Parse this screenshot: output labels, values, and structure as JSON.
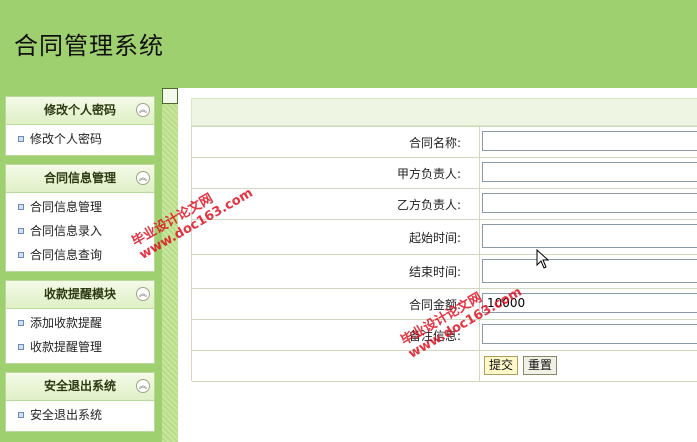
{
  "app": {
    "title": "合同管理系统"
  },
  "sidebar": {
    "panels": [
      {
        "title": "修改个人密码",
        "items": [
          "修改个人密码"
        ]
      },
      {
        "title": "合同信息管理",
        "items": [
          "合同信息管理",
          "合同信息录入",
          "合同信息查询"
        ]
      },
      {
        "title": "收款提醒模块",
        "items": [
          "添加收款提醒",
          "收款提醒管理"
        ]
      },
      {
        "title": "安全退出系统",
        "items": [
          "安全退出系统"
        ]
      }
    ]
  },
  "form": {
    "contract_name_label": "合同名称:",
    "party_a_label": "甲方负责人:",
    "party_b_label": "乙方负责人:",
    "start_time_label": "起始时间:",
    "end_time_label": "结束时间:",
    "amount_label": "合同金额:",
    "remark_label": "备注信息:",
    "contract_name_value": "",
    "party_a_value": "",
    "party_b_value": "",
    "start_time_value": "",
    "end_time_value": "",
    "amount_value": "10000",
    "remark_value": "",
    "submit_label": "提交",
    "reset_label": "重置"
  },
  "watermark": {
    "line1": "毕业设计论文网",
    "line2": "www.doc163.com"
  },
  "colors": {
    "header_bg": "#9fd06f",
    "panel_border": "#bcd89a",
    "watermark": "#e01020"
  }
}
